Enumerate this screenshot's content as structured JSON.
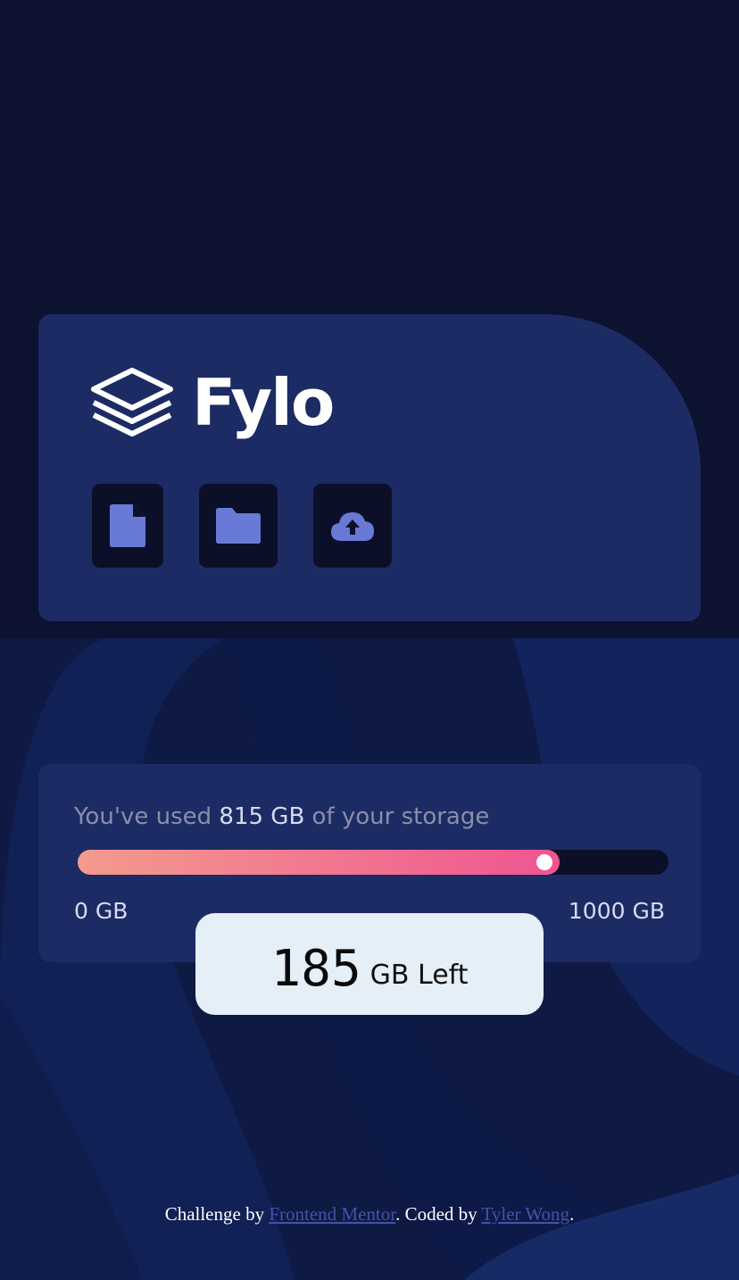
{
  "brand": {
    "name": "Fylo"
  },
  "icons": {
    "logo": "layers-icon",
    "document": "document-icon",
    "folder": "folder-icon",
    "upload": "cloud-upload-icon"
  },
  "storage": {
    "prefix": "You've used",
    "used": "815 GB",
    "suffix": "of your storage",
    "used_fraction": 0.815,
    "min_label": "0 GB",
    "max_label": "1000 GB",
    "remaining_value": "185",
    "remaining_unit": "GB Left"
  },
  "footer": {
    "challenge_prefix": "Challenge by",
    "challenge_link": "Frontend Mentor",
    "coded_prefix": ". Coded by",
    "coded_link": "Tyler Wong",
    "suffix": "."
  },
  "colors": {
    "background": "#0c1230",
    "card": "#1c2b64",
    "icon_tile": "#0b1028",
    "icon": "#6879d6",
    "gradient_start": "#f39b8e",
    "gradient_end": "#ef5591",
    "pill": "#e5eff8",
    "link": "#4453a6"
  }
}
